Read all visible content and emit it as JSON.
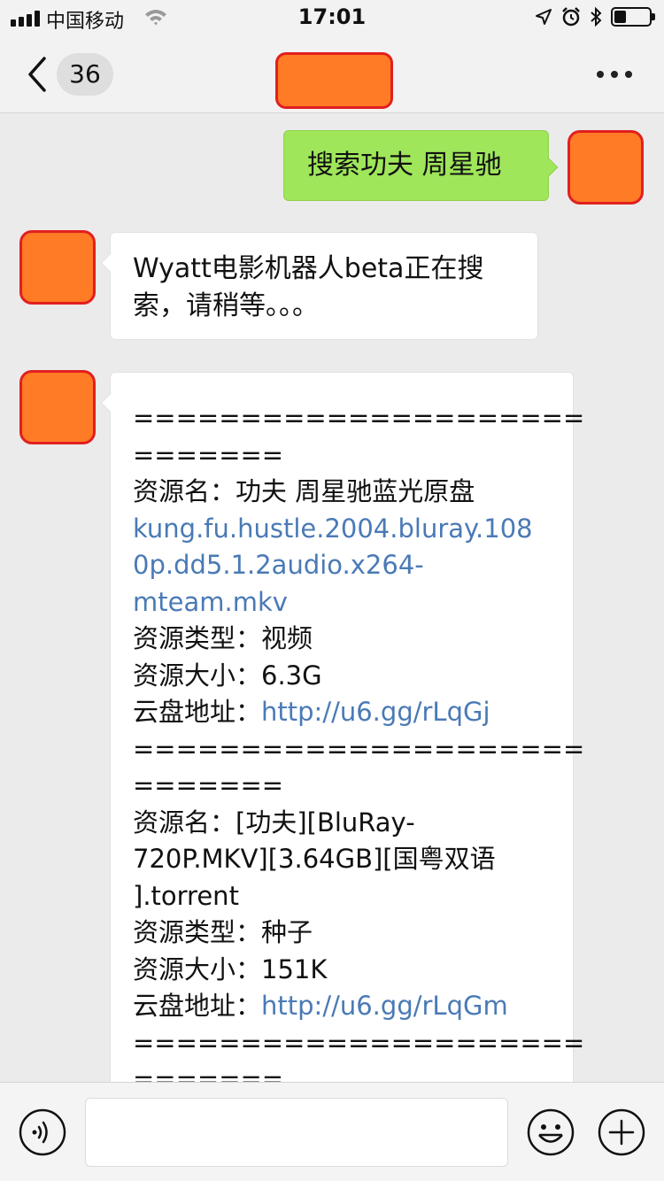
{
  "status_bar": {
    "carrier": "中国移动",
    "time": "17:01",
    "battery_level": 0.35
  },
  "nav": {
    "unread_count": "36"
  },
  "messages": {
    "outgoing_1": "搜索功夫 周星驰",
    "incoming_1": [
      "Wyatt电影机器人beta正在搜",
      "索，请稍等。。。"
    ],
    "results": [
      {
        "text": "=====================",
        "link": false
      },
      {
        "text": "=======",
        "link": false
      },
      {
        "text": "资源名：功夫 周星驰蓝光原盘",
        "link": false
      },
      {
        "text": "kung.fu.hustle.2004.bluray.108",
        "link": true
      },
      {
        "text": "0p.dd5.1.2audio.x264-",
        "link": true
      },
      {
        "text": "mteam.mkv",
        "link": true
      },
      {
        "text": "资源类型：视频",
        "link": false
      },
      {
        "text": "资源大小：6.3G",
        "link": false
      },
      {
        "label": "云盘地址：",
        "url": "http://u6.gg/rLqGj"
      },
      {
        "text": "=====================",
        "link": false
      },
      {
        "text": "=======",
        "link": false
      },
      {
        "text": "资源名：[功夫][BluRay-",
        "link": false
      },
      {
        "text": "720P.MKV][3.64GB][国粤双语",
        "link": false
      },
      {
        "text": "].torrent",
        "link": false
      },
      {
        "text": "资源类型：种子",
        "link": false
      },
      {
        "text": "资源大小：151K",
        "link": false
      },
      {
        "label": "云盘地址：",
        "url": "http://u6.gg/rLqGm"
      },
      {
        "text": "=====================",
        "link": false
      },
      {
        "text": "=======",
        "link": false
      }
    ]
  },
  "input": {
    "value": ""
  },
  "colors": {
    "outgoing_bubble": "#9fe65a",
    "incoming_bubble": "#ffffff",
    "link": "#4a7ab6",
    "redacted_fill": "#ff7b25",
    "redacted_border": "#e21f1f"
  },
  "icons": {
    "back": "chevron-left-icon",
    "more": "ellipsis-icon",
    "voice": "voice-icon",
    "emoji": "smiley-icon",
    "plus": "plus-icon",
    "wifi": "wifi-icon",
    "location": "location-arrow-icon",
    "alarm": "alarm-icon",
    "bluetooth": "bluetooth-icon",
    "battery": "battery-icon"
  }
}
